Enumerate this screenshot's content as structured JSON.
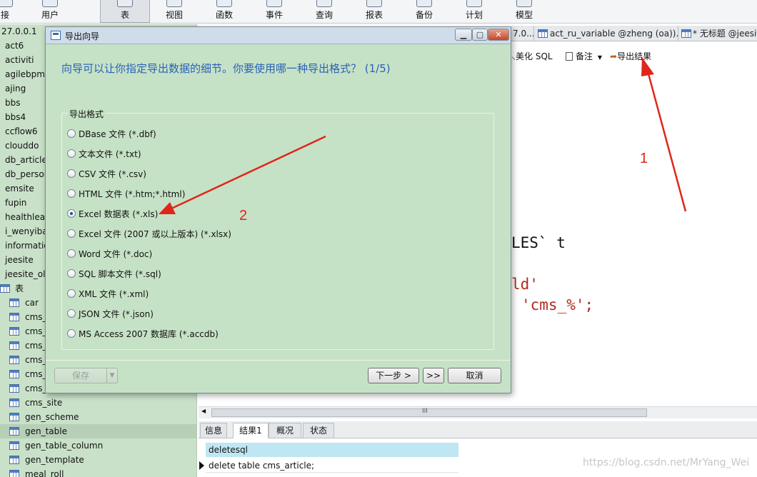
{
  "toolbar": {
    "items": [
      {
        "label": "接",
        "icon": "connection-icon"
      },
      {
        "label": "用户",
        "icon": "user-icon"
      },
      {
        "label": "表",
        "icon": "table-icon"
      },
      {
        "label": "视图",
        "icon": "view-icon"
      },
      {
        "label": "函数",
        "icon": "function-icon"
      },
      {
        "label": "事件",
        "icon": "event-icon"
      },
      {
        "label": "查询",
        "icon": "query-icon"
      },
      {
        "label": "报表",
        "icon": "report-icon"
      },
      {
        "label": "备份",
        "icon": "backup-icon"
      },
      {
        "label": "计划",
        "icon": "schedule-icon"
      },
      {
        "label": "模型",
        "icon": "model-icon"
      }
    ]
  },
  "nav": {
    "items": [
      {
        "label": "27.0.0.1"
      },
      {
        "label": "act6"
      },
      {
        "label": "activiti"
      },
      {
        "label": "agilebpm"
      },
      {
        "label": "ajing"
      },
      {
        "label": "bbs"
      },
      {
        "label": "bbs4"
      },
      {
        "label": "ccflow6"
      },
      {
        "label": "clouddo"
      },
      {
        "label": "db_article"
      },
      {
        "label": "db_person"
      },
      {
        "label": "emsite"
      },
      {
        "label": "fupin"
      },
      {
        "label": "healthlearn"
      },
      {
        "label": "i_wenyiba"
      },
      {
        "label": "information"
      },
      {
        "label": "jeesite"
      },
      {
        "label": "jeesite_old"
      },
      {
        "label": "表"
      },
      {
        "label": "car"
      },
      {
        "label": "cms_"
      },
      {
        "label": "cms_"
      },
      {
        "label": "cms_"
      },
      {
        "label": "cms_"
      },
      {
        "label": "cms_"
      },
      {
        "label": "cms_"
      },
      {
        "label": "cms_site"
      },
      {
        "label": "gen_scheme"
      },
      {
        "label": "gen_table"
      },
      {
        "label": "gen_table_column"
      },
      {
        "label": "gen_template"
      },
      {
        "label": "meal_roll"
      }
    ]
  },
  "tabs": [
    {
      "label": "7.0..."
    },
    {
      "label": "act_ru_variable @zheng (oa))..."
    },
    {
      "label": "* 无标题 @jeesite"
    }
  ],
  "editor_toolbar": {
    "beautify": "美化 SQL",
    "comment": "备注",
    "export": "导出结果"
  },
  "editor": {
    "line1": "LES` t",
    "line2": "ld'",
    "line3": "'cms_%';"
  },
  "hscroll_label": "III",
  "result_tabs": [
    {
      "label": "信息"
    },
    {
      "label": "结果1"
    },
    {
      "label": "概况"
    },
    {
      "label": "状态"
    }
  ],
  "grid": {
    "column": "deletesql",
    "row": "delete table cms_article;"
  },
  "watermark": "https://blog.csdn.net/MrYang_Wei",
  "dialog": {
    "title": "导出向导",
    "question": "向导可以让你指定导出数据的细节。你要使用哪一种导出格式？ (1/5)",
    "group_label": "导出格式",
    "options": [
      {
        "label": "DBase 文件 (*.dbf)",
        "checked": false
      },
      {
        "label": "文本文件 (*.txt)",
        "checked": false
      },
      {
        "label": "CSV 文件 (*.csv)",
        "checked": false
      },
      {
        "label": "HTML 文件 (*.htm;*.html)",
        "checked": false
      },
      {
        "label": "Excel 数据表 (*.xls)",
        "checked": true
      },
      {
        "label": "Excel 文件 (2007 或以上版本) (*.xlsx)",
        "checked": false
      },
      {
        "label": "Word 文件 (*.doc)",
        "checked": false
      },
      {
        "label": "SQL 脚本文件 (*.sql)",
        "checked": false
      },
      {
        "label": "XML 文件 (*.xml)",
        "checked": false
      },
      {
        "label": "JSON 文件 (*.json)",
        "checked": false
      },
      {
        "label": "MS Access 2007 数据库 (*.accdb)",
        "checked": false
      }
    ],
    "save": "保存",
    "next": "下一步 >",
    "skip": ">>",
    "cancel": "取消"
  },
  "annotations": {
    "n1": "1",
    "n2": "2",
    "color": "#e0261b"
  }
}
